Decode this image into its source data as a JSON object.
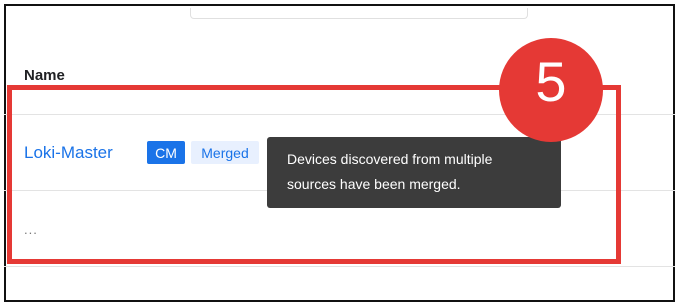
{
  "table": {
    "column_header": "Name",
    "row": {
      "name": "Loki-Master",
      "badges": {
        "cm": "CM",
        "merged": "Merged"
      }
    },
    "more": "..."
  },
  "tooltip": {
    "line1": "Devices discovered from multiple",
    "line2": "sources have been merged."
  },
  "annotation": {
    "step": "5"
  },
  "colors": {
    "link": "#1a73e8",
    "badge_cm_bg": "#1a73e8",
    "badge_merged_bg": "#e8f0fe",
    "tooltip_bg": "#3c3c3c",
    "highlight": "#e53935"
  }
}
